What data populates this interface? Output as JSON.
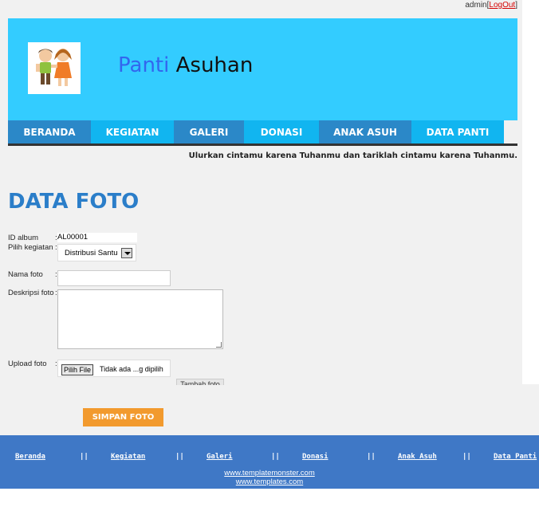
{
  "topbar": {
    "user": "admin",
    "logout": "LogOut",
    "open": "[",
    "close": "]"
  },
  "header": {
    "title_part1": "Panti",
    "title_part2": "Asuhan"
  },
  "nav": [
    {
      "label": "BERANDA"
    },
    {
      "label": "KEGIATAN"
    },
    {
      "label": "GALERI"
    },
    {
      "label": "DONASI"
    },
    {
      "label": "ANAK ASUH"
    },
    {
      "label": "DATA PANTI"
    }
  ],
  "tagline": "Ulurkan cintamu karena Tuhanmu dan tariklah cintamu karena Tuhanmu.",
  "page_title": "DATA FOTO",
  "form": {
    "id_album_label": "ID album",
    "id_album_value": "AL00001",
    "kegiatan_label": "Pilih kegiatan",
    "kegiatan_value": "Distribusi Santu",
    "nama_label": "Nama foto",
    "deskripsi_label": "Deskripsi foto",
    "upload_label": "Upload foto",
    "file_button": "Pilih File",
    "file_status": "Tidak ada ...g dipilih",
    "tambah_label": "Tambah foto",
    "colon": ":",
    "save_label": "SIMPAN FOTO"
  },
  "footer": {
    "links": [
      "Beranda",
      "Kegiatan",
      "Galeri",
      "Donasi",
      "Anak Asuh",
      "Data Panti"
    ],
    "separator": "||",
    "credit1": "www.templatemonster.com",
    "credit2": "www.templates.com"
  },
  "colors": {
    "header_bg": "#33ccff",
    "nav_dark": "#2b88c8",
    "nav_light": "#11b5f0",
    "title_blue": "#2b7ec9",
    "save_orange": "#f29a2e",
    "footer_bg": "#3f78c6"
  }
}
